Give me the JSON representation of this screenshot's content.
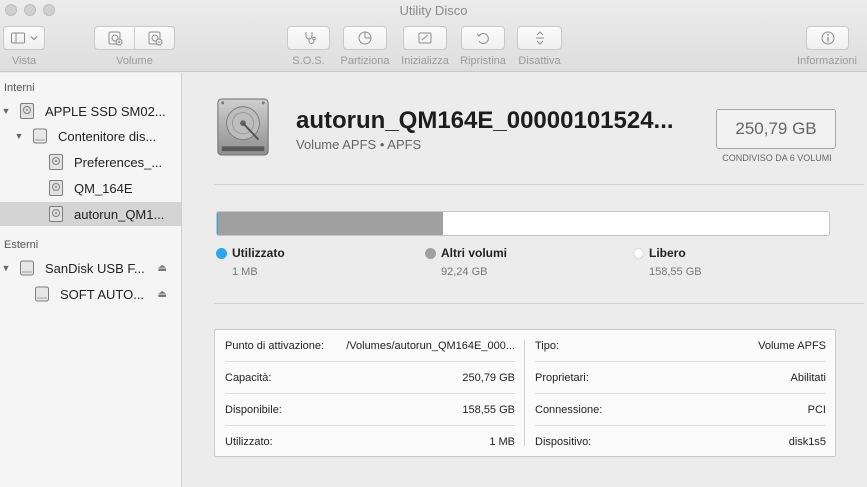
{
  "window": {
    "title": "Utility Disco"
  },
  "toolbar": {
    "vista": "Vista",
    "volume": "Volume",
    "sos": "S.O.S.",
    "partiziona": "Partiziona",
    "inizializza": "Inizializza",
    "ripristina": "Ripristina",
    "disattiva": "Disattiva",
    "informazioni": "Informazioni"
  },
  "sidebar": {
    "internal_header": "Interni",
    "external_header": "Esterni",
    "internal": [
      {
        "label": "APPLE SSD SM02...",
        "icon": "internal-disk-icon"
      },
      {
        "label": "Contenitore dis...",
        "icon": "container-icon"
      },
      {
        "label": "Preferences_...",
        "icon": "volume-icon"
      },
      {
        "label": "QM_164E",
        "icon": "volume-icon"
      },
      {
        "label": "autorun_QM1...",
        "icon": "volume-icon"
      }
    ],
    "external": [
      {
        "label": "SanDisk USB F...",
        "icon": "external-disk-icon"
      },
      {
        "label": "SOFT AUTO...",
        "icon": "external-volume-icon"
      }
    ]
  },
  "volume": {
    "name": "autorun_QM164E_00000101524...",
    "subtitle": "Volume APFS • APFS",
    "capacity": "250,79 GB",
    "shared_note": "CONDIVISO DA 6 VOLUMI"
  },
  "usage": {
    "used_fraction": 3.8e-06,
    "other_fraction": 0.3678,
    "colors": {
      "used": "#2aa7e9",
      "other": "#a0a0a0",
      "free": "#ffffff"
    },
    "legend": [
      {
        "name": "Utilizzato",
        "value": "1 MB",
        "color": "#2aa7e9"
      },
      {
        "name": "Altri volumi",
        "value": "92,24 GB",
        "color": "#a0a0a0"
      },
      {
        "name": "Libero",
        "value": "158,55 GB",
        "color": "#ffffff"
      }
    ]
  },
  "info": {
    "left": [
      {
        "key": "Punto di attivazione:",
        "value": "/Volumes/autorun_QM164E_000..."
      },
      {
        "key": "Capacità:",
        "value": "250,79 GB"
      },
      {
        "key": "Disponibile:",
        "value": "158,55 GB"
      },
      {
        "key": "Utilizzato:",
        "value": "1 MB"
      }
    ],
    "right": [
      {
        "key": "Tipo:",
        "value": "Volume APFS"
      },
      {
        "key": "Proprietari:",
        "value": "Abilitati"
      },
      {
        "key": "Connessione:",
        "value": "PCI"
      },
      {
        "key": "Dispositivo:",
        "value": "disk1s5"
      }
    ]
  }
}
